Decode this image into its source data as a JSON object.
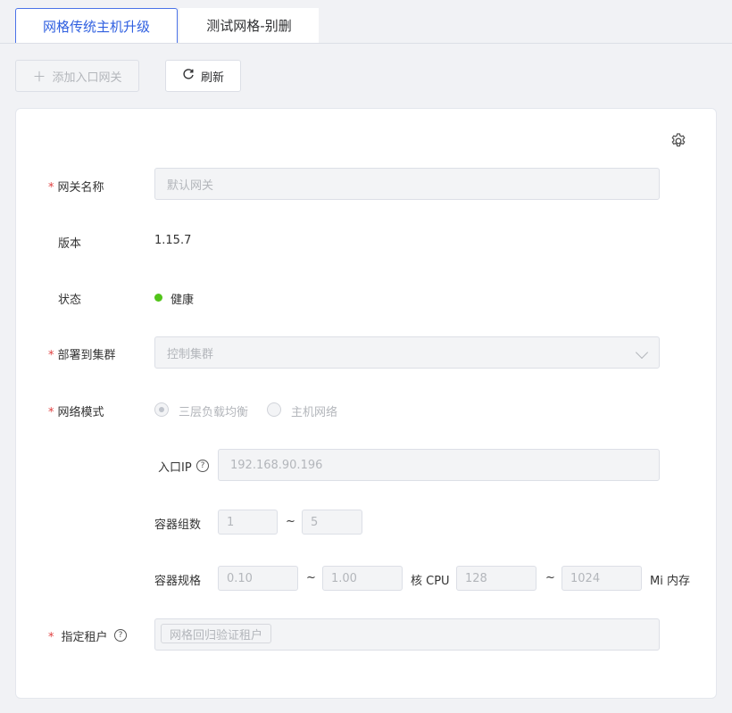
{
  "tabs": [
    {
      "label": "网格传统主机升级",
      "active": true
    },
    {
      "label": "测试网格-别删",
      "active": false
    }
  ],
  "toolbar": {
    "add_label": "添加入口网关",
    "add_icon": "plus-icon",
    "refresh_label": "刷新",
    "refresh_icon": "refresh-icon"
  },
  "settings_icon": "gear-icon",
  "form": {
    "gateway_name": {
      "label": "网关名称",
      "required": true,
      "placeholder": "默认网关"
    },
    "version": {
      "label": "版本",
      "value": "1.15.7"
    },
    "status": {
      "label": "状态",
      "value": "健康",
      "color": "#52c41a"
    },
    "cluster": {
      "label": "部署到集群",
      "required": true,
      "value": "控制集群"
    },
    "network_mode": {
      "label": "网络模式",
      "required": true,
      "options": [
        "三层负载均衡",
        "主机网络"
      ],
      "selected": "三层负载均衡"
    },
    "entry_ip": {
      "label": "入口IP",
      "value": "192.168.90.196"
    },
    "replicas": {
      "label": "容器组数",
      "min": "1",
      "max": "5",
      "separator": "~"
    },
    "spec": {
      "label": "容器规格",
      "cpu_min": "0.10",
      "cpu_max": "1.00",
      "cpu_unit": "核 CPU",
      "mem_min": "128",
      "mem_max": "1024",
      "mem_unit": "Mi 内存",
      "separator": "~"
    },
    "tenant": {
      "label": "指定租户",
      "required": true,
      "tag": "网格回归验证租户"
    }
  },
  "colors": {
    "accent": "#2f5fe0",
    "required": "#e04040"
  }
}
